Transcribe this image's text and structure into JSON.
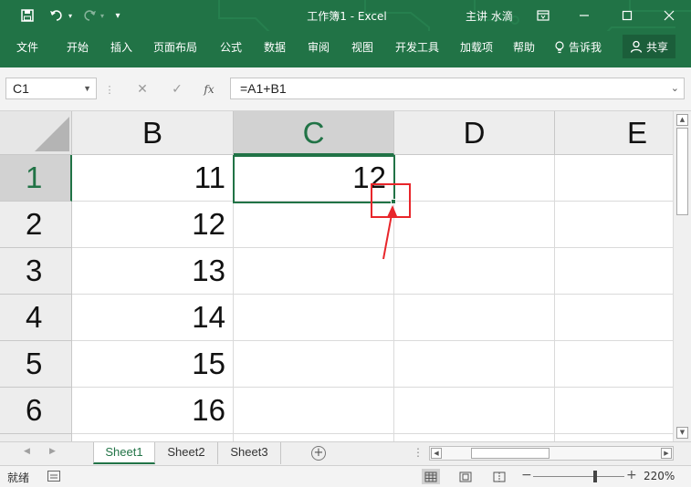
{
  "titlebar": {
    "title": "工作簿1  -  Excel",
    "user": "主讲 水滴"
  },
  "ribbon": {
    "tabs": [
      "文件",
      "开始",
      "插入",
      "页面布局",
      "公式",
      "数据",
      "审阅",
      "视图",
      "开发工具",
      "加载项",
      "帮助"
    ],
    "tellme": "告诉我",
    "share": "共享"
  },
  "formula_bar": {
    "name_box": "C1",
    "fx_label": "fx",
    "formula": "=A1+B1"
  },
  "grid": {
    "columns": [
      "B",
      "C",
      "D",
      "E"
    ],
    "selected_column": "C",
    "rows": [
      {
        "number": "1",
        "b": "11",
        "c": "12"
      },
      {
        "number": "2",
        "b": "12",
        "c": ""
      },
      {
        "number": "3",
        "b": "13",
        "c": ""
      },
      {
        "number": "4",
        "b": "14",
        "c": ""
      },
      {
        "number": "5",
        "b": "15",
        "c": ""
      },
      {
        "number": "6",
        "b": "16",
        "c": ""
      }
    ],
    "active_cell": "C1"
  },
  "sheets": {
    "tabs": [
      "Sheet1",
      "Sheet2",
      "Sheet3"
    ],
    "active": "Sheet1"
  },
  "statusbar": {
    "status": "就绪",
    "zoom": "220%"
  },
  "colors": {
    "excel_green": "#217346",
    "annotation_red": "#e8262b"
  }
}
